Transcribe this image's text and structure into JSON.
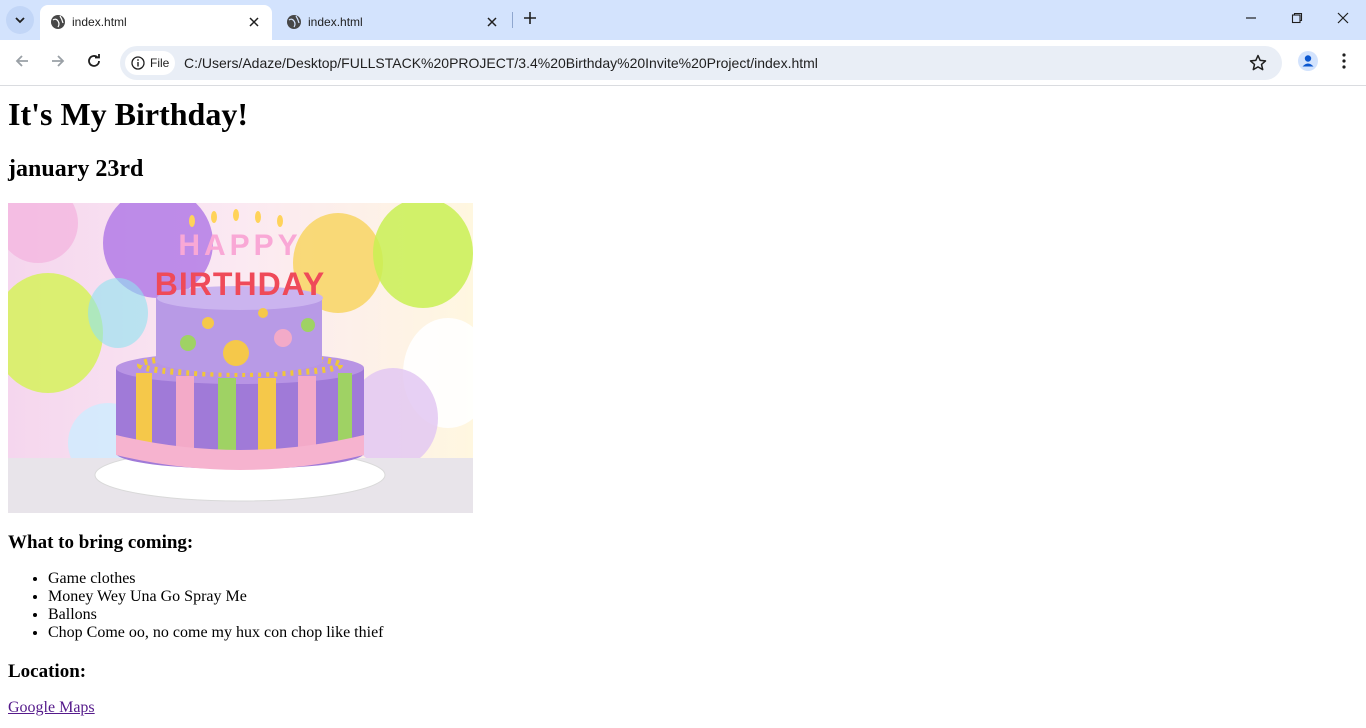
{
  "browser": {
    "tabs": [
      {
        "title": "index.html",
        "active": true
      },
      {
        "title": "index.html",
        "active": false
      }
    ],
    "address_chip": "File",
    "url": "C:/Users/Adaze/Desktop/FULLSTACK%20PROJECT/3.4%20Birthday%20Invite%20Project/index.html",
    "icons": {
      "tab_search": "chevron-down-icon",
      "favicon": "globe-icon",
      "close": "close-icon",
      "new_tab": "plus-icon",
      "back": "back-arrow-icon",
      "forward": "forward-arrow-icon",
      "reload": "reload-icon",
      "info": "info-icon",
      "bookmark": "star-icon",
      "profile": "profile-icon",
      "menu": "kebab-menu-icon",
      "minimize": "minimize-icon",
      "restore": "restore-icon",
      "close_window": "close-window-icon"
    },
    "colors": {
      "tab_strip": "#d3e3fd",
      "omnibox": "#e9eef6",
      "profile": "#0b57d0"
    }
  },
  "page": {
    "heading": "It's My Birthday!",
    "date": "january 23rd",
    "image_text": "HAPPY BIRTHDAY",
    "bring_heading": "What to bring coming:",
    "bring_items": [
      "Game clothes",
      "Money Wey Una Go Spray Me",
      "Ballons",
      "Chop Come oo, no come my hux con chop like thief"
    ],
    "location_heading": "Location:",
    "map_link": "Google Maps",
    "link_color": "#551a8b"
  }
}
